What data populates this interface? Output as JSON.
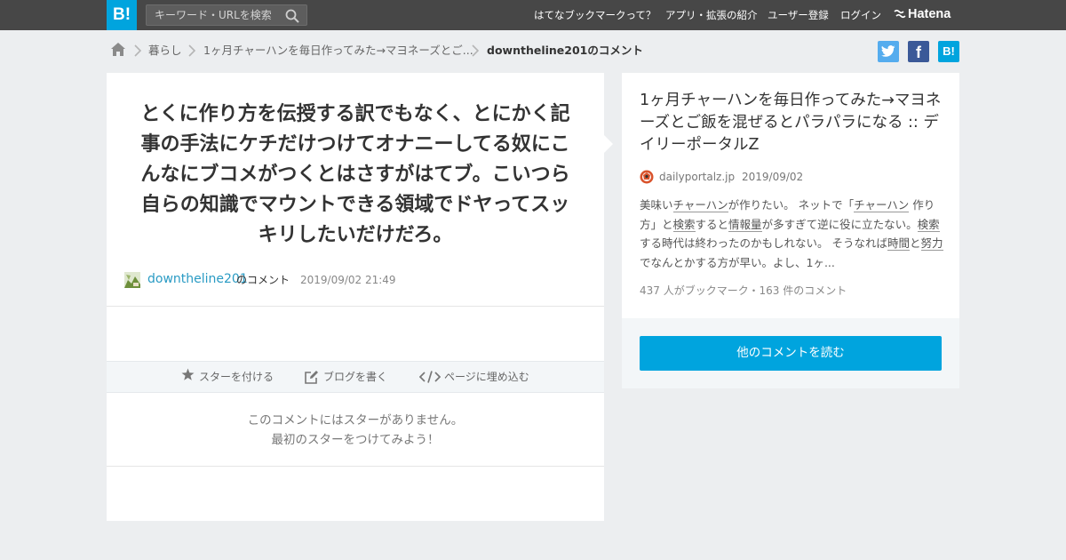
{
  "topbar": {
    "logo": "B!",
    "search_placeholder": "キーワード・URLを検索",
    "nav": {
      "about": "はてなブックマークって？",
      "apps": "アプリ・拡張の紹介",
      "register": "ユーザー登録",
      "login": "ログイン",
      "brand": "Hatena"
    }
  },
  "breadcrumb": {
    "category": "暮らし",
    "entry": "1ヶ月チャーハンを毎日作ってみた→マヨネーズとご...",
    "current": "downtheline201のコメント"
  },
  "share": {
    "facebook": "f",
    "hatena": "B!"
  },
  "comment": {
    "text": "とくに作り方を伝授する訳でもなく、とにかく記事の手法にケチだけつけてオナニーしてる奴にこんなにブコメがつくとはさすがはてブ。こいつら自らの知識でマウントできる領域でドヤってスッキリしたいだけだろ。",
    "user": "downtheline201",
    "no_comment": "のコメント",
    "date": "2019/09/02 21:49"
  },
  "actions": {
    "star": "スターを付ける",
    "blog": "ブログを書く",
    "embed": "ページに埋め込む"
  },
  "stars": {
    "line1": "このコメントにはスターがありません。",
    "line2": "最初のスターをつけてみよう！"
  },
  "entry": {
    "title": "1ヶ月チャーハンを毎日作ってみた→マヨネーズとご飯を混ぜるとパラパラになる :: デイリーポータルZ",
    "domain": "dailyportalz.jp",
    "date": "2019/09/02",
    "summary": {
      "s1": "美味い",
      "k1": "チャーハン",
      "s2": "が作りたい。 ネットで「",
      "k2": "チャーハン",
      "s3": " 作り方」と",
      "k3": "検索",
      "s4": "すると",
      "k4": "情報量",
      "s5": "が多すぎて逆に役に立たない。",
      "k5": "検索",
      "s6": "する時代は終わったのかもしれない。 そうなれば",
      "k6": "時間",
      "s7": "と",
      "k7": "努力",
      "s8": "でなんとかする方が早い。よし、1ヶ..."
    },
    "stats": "437 人がブックマーク・163 件のコメント",
    "read_more": "他のコメントを読む"
  },
  "colors": {
    "topbar": "#474747",
    "accent": "#00a4de",
    "twitter": "#55acee",
    "facebook": "#3b5998",
    "hatena": "#00a4de",
    "link": "#2a9bc4"
  }
}
